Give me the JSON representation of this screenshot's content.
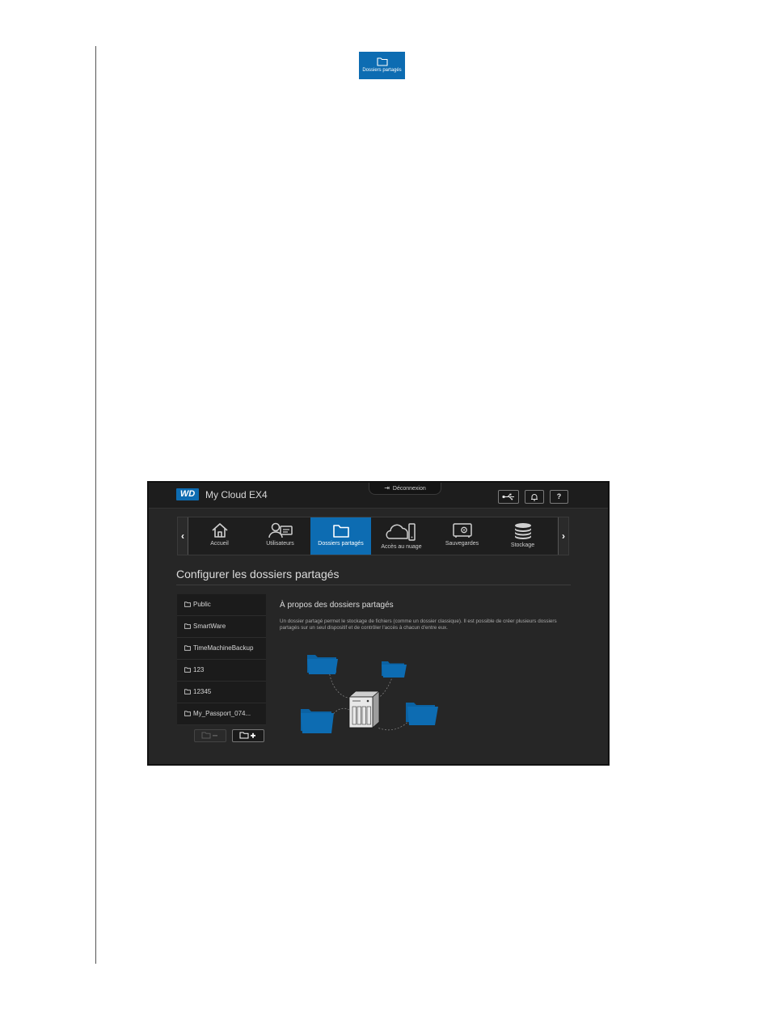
{
  "doc_icon": {
    "label": "Dossiers partagés",
    "color": "#0d6cb2"
  },
  "app": {
    "logo": "WD",
    "product": "My Cloud EX4",
    "logout": "Déconnexion",
    "help": "?"
  },
  "nav": {
    "prev": "‹",
    "next": "›",
    "items": [
      {
        "label": "Accueil",
        "icon": "home-icon"
      },
      {
        "label": "Utilisateurs",
        "icon": "users-icon"
      },
      {
        "label": "Dossiers partagés",
        "icon": "folder-icon",
        "active": true
      },
      {
        "label": "Accès au nuage",
        "icon": "cloud-access-icon"
      },
      {
        "label": "Sauvegardes",
        "icon": "safe-icon"
      },
      {
        "label": "Stockage",
        "icon": "storage-icon"
      }
    ]
  },
  "main": {
    "title": "Configurer les dossiers partagés",
    "shares": [
      "Public",
      "SmartWare",
      "TimeMachineBackup",
      "123",
      "12345",
      "My_Passport_074..."
    ],
    "about_title": "À propos des dossiers partagés",
    "about_text": "Un dossier partagé permet le stockage de fichiers (comme un dossier classique). Il est possible de créer plusieurs dossiers partagés sur un seul dispositif et de contrôler l'accès à chacun d'entre eux."
  },
  "colors": {
    "accent": "#0d6cb2",
    "panel": "#262626",
    "topbar": "#1d1d1d"
  }
}
